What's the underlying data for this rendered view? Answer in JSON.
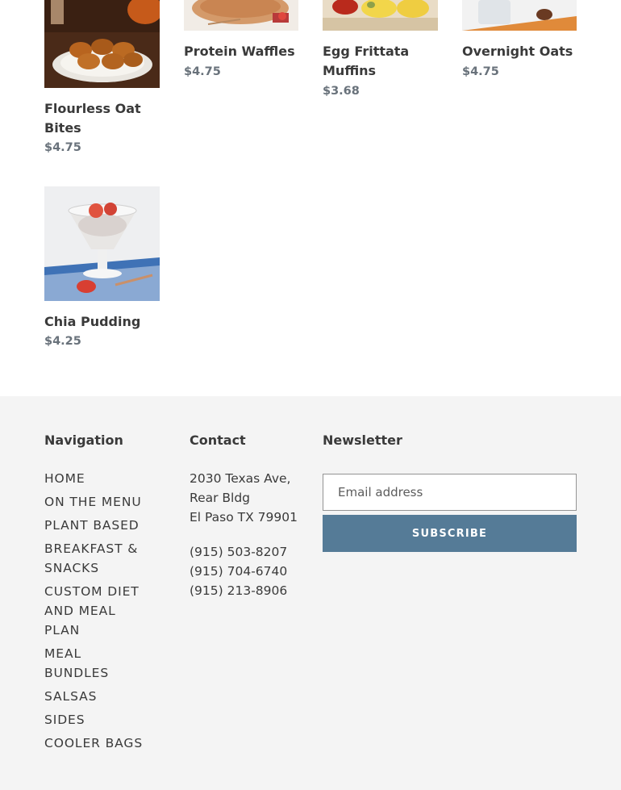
{
  "products": [
    {
      "title": "Flourless Oat Bites",
      "price": "$4.75",
      "image": "oat-bites-photo"
    },
    {
      "title": "Protein Waffles",
      "price": "$4.75",
      "image": "waffles-photo"
    },
    {
      "title": "Egg Frittata Muffins",
      "price": "$3.68",
      "image": "frittata-photo"
    },
    {
      "title": "Overnight Oats",
      "price": "$4.75",
      "image": "overnight-oats-photo"
    },
    {
      "title": "Chia Pudding",
      "price": "$4.25",
      "image": "chia-pudding-photo"
    }
  ],
  "footer": {
    "navigation": {
      "heading": "Navigation",
      "items": [
        "HOME",
        "ON THE MENU",
        "PLANT BASED",
        "BREAKFAST & SNACKS",
        "CUSTOM DIET AND MEAL PLAN",
        "MEAL BUNDLES",
        "SALSAS",
        "SIDES",
        "COOLER BAGS"
      ]
    },
    "contact": {
      "heading": "Contact",
      "address_line1": "2030 Texas Ave,",
      "address_line2": "Rear Bldg",
      "address_line3": "El Paso TX 79901",
      "phones": [
        "(915) 503-8207",
        "(915) 704-6740",
        "(915) 213-8906"
      ]
    },
    "newsletter": {
      "heading": "Newsletter",
      "email_placeholder": "Email address",
      "subscribe_label": "SUBSCRIBE"
    }
  },
  "colors": {
    "price": "#69727b",
    "footer_bg": "#f4f4f4",
    "button": "#557b97"
  }
}
